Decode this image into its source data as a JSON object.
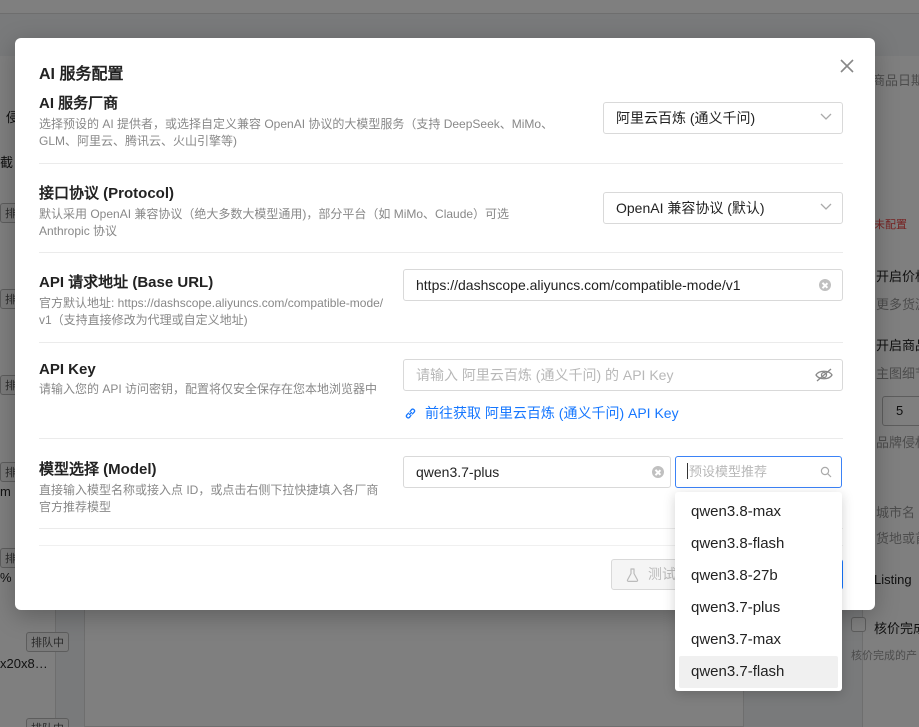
{
  "background": {
    "frags": [
      "商品日期",
      "侵",
      "截",
      "排",
      "排",
      "排",
      "排",
      "排",
      "m",
      "排",
      "% H",
      "排队中",
      "x20x8…",
      "排队中",
      "未配置",
      "开启价格",
      "更多货源",
      "开启商品",
      "主图细节",
      "5",
      "品牌侵权",
      "城市名",
      "货地或首",
      "Listing",
      "核价完成",
      "核价完成的产"
    ]
  },
  "modal": {
    "title": "AI 服务配置",
    "provider": {
      "label": "AI 服务厂商",
      "desc": "选择预设的 AI 提供者，或选择自定义兼容 OpenAI 协议的大模型服务（支持 DeepSeek、MiMo、GLM、阿里云、腾讯云、火山引擎等)",
      "value": "阿里云百炼 (通义千问)"
    },
    "protocol": {
      "label": "接口协议 (Protocol)",
      "desc": "默认采用 OpenAI 兼容协议（绝大多数大模型通用)，部分平台（如 MiMo、Claude）可选 Anthropic 协议",
      "value": "OpenAI 兼容协议 (默认)"
    },
    "base_url": {
      "label": "API 请求地址 (Base URL)",
      "desc": "官方默认地址: https://dashscope.aliyuncs.com/compatible-mode/v1（支持直接修改为代理或自定义地址)",
      "value": "https://dashscope.aliyuncs.com/compatible-mode/v1"
    },
    "api_key": {
      "label": "API Key",
      "desc": "请输入您的 API 访问密钥，配置将仅安全保存在您本地浏览器中",
      "placeholder": "请输入 阿里云百炼 (通义千问) 的 API Key",
      "link": "前往获取 阿里云百炼 (通义千问) API Key"
    },
    "model": {
      "label": "模型选择 (Model)",
      "desc": "直接输入模型名称或接入点 ID，或点击右侧下拉快捷填入各厂商官方推荐模型",
      "value": "qwen3.7-plus",
      "preset_placeholder": "预设模型推荐",
      "options": [
        "qwen3.8-max",
        "qwen3.8-flash",
        "qwen3.8-27b",
        "qwen3.7-plus",
        "qwen3.7-max",
        "qwen3.7-flash"
      ]
    },
    "footer": {
      "test_label": "测试"
    }
  }
}
